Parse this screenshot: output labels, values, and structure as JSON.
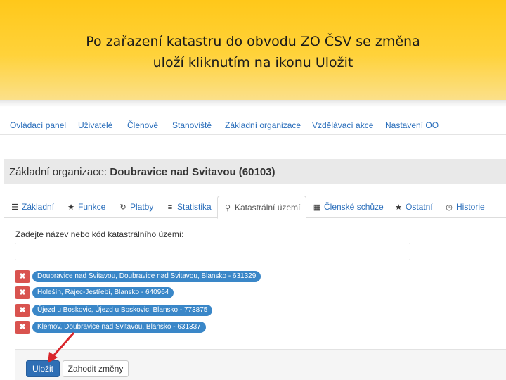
{
  "slide": {
    "title_line1": "Po zařazení katastru do obvodu ZO ČSV se změna",
    "title_line2": "uloží kliknutím na ikonu Uložit"
  },
  "main_nav": [
    "Ovládací panel",
    "Uživatelé",
    "Členové",
    "Stanoviště",
    "Základní organizace",
    "Vzdělávací akce",
    "Nastavení OO"
  ],
  "org": {
    "label": "Základní organizace: ",
    "name": "Doubravice nad Svitavou (60103)"
  },
  "tabs": [
    {
      "icon": "list-icon",
      "label": "Základní"
    },
    {
      "icon": "star-icon",
      "label": "Funkce"
    },
    {
      "icon": "refresh-icon",
      "label": "Platby"
    },
    {
      "icon": "bars-icon",
      "label": "Statistika"
    },
    {
      "icon": "map-marker-icon",
      "label": "Katastrální území",
      "active": true
    },
    {
      "icon": "calendar-icon",
      "label": "Členské schůze"
    },
    {
      "icon": "star-icon",
      "label": "Ostatní"
    },
    {
      "icon": "clock-icon",
      "label": "Historie"
    }
  ],
  "cadastre": {
    "field_label": "Zadejte název nebo kód katastrálního území:",
    "input_value": "",
    "remove_symbol": "✖",
    "items": [
      "Doubravice nad Svitavou, Doubravice nad Svitavou, Blansko - 631329",
      "Holešín, Rájec-Jestřebí, Blansko - 640964",
      "Újezd u Boskovic, Újezd u Boskovic, Blansko - 773875",
      "Klemov, Doubravice nad Svitavou, Blansko - 631337"
    ]
  },
  "actions": {
    "save_label": "Uložit",
    "discard_label": "Zahodit změny"
  },
  "colors": {
    "header_yellow": "#ffc81a",
    "link_blue": "#2a6ebb",
    "tag_blue": "#3a87c8",
    "remove_red": "#d9534f",
    "save_blue": "#2f6fb5",
    "arrow_red": "#d9262b"
  }
}
